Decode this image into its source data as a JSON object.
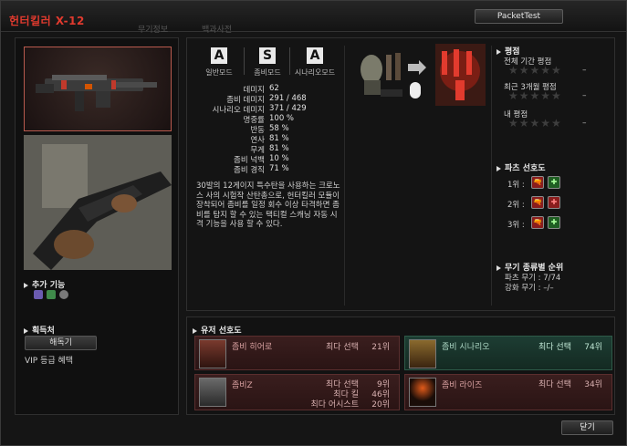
{
  "window": {
    "title": "헌터킬러 X-12",
    "ghost_tabs": [
      "무기정보",
      "백과사전"
    ],
    "top_button": "PacketTest",
    "close_button": "닫기"
  },
  "left": {
    "features_heading": "추가 기능",
    "acquisition_heading": "획득처",
    "dismantle_button": "해독기",
    "vip_text": "VIP 등급 혜택"
  },
  "modes": [
    {
      "grade": "A",
      "label": "일반모드"
    },
    {
      "grade": "S",
      "label": "좀비모드"
    },
    {
      "grade": "A",
      "label": "시나리오모드"
    }
  ],
  "stats": [
    {
      "key": "데미지",
      "value": "62"
    },
    {
      "key": "좀비 데미지",
      "value": "291 / 468"
    },
    {
      "key": "시나리오 데미지",
      "value": "371 / 429"
    },
    {
      "key": "명중률",
      "value": "100 %"
    },
    {
      "key": "반동",
      "value": "58 %"
    },
    {
      "key": "연사",
      "value": "81 %"
    },
    {
      "key": "무게",
      "value": "81 %"
    },
    {
      "key": "좀비 넉백",
      "value": "10 %"
    },
    {
      "key": "좀비 경직",
      "value": "71 %"
    }
  ],
  "description": "30발의 12게이지 특수탄을 사용하는 크로노스 사의 시험작 산탄총으로, 헌터킬러 모듈이 장착되어 좀비를 일정 회수 이상 타격하면 좀비를 탐지 할 수 있는 택티컬 스캐닝 자동 시격 기능을 사용 할 수 있다.",
  "ratings": {
    "heading": "평점",
    "items": [
      {
        "label": "전체 기간 평점",
        "stars": "★★★★★",
        "value": "–"
      },
      {
        "label": "최근 3개월 평점",
        "stars": "★★★★★",
        "value": "–"
      },
      {
        "label": "내 평점",
        "stars": "★★★★★",
        "value": "–"
      }
    ]
  },
  "faction": {
    "heading": "파츠 선호도",
    "ranks": [
      {
        "label": "1위 :",
        "badge_a": "🔫",
        "badge_b": "✚"
      },
      {
        "label": "2위 :",
        "badge_a": "🔫",
        "badge_b": "✚"
      },
      {
        "label": "3위 :",
        "badge_a": "🔫",
        "badge_b": "✚"
      }
    ]
  },
  "weapon_rank": {
    "heading": "무기 종류별 순위",
    "lines": [
      "파츠 무기 : 7/74",
      "강화 무기 : –/–"
    ]
  },
  "user_pref": {
    "heading": "유저 선호도",
    "cards": [
      {
        "name": "좀비 히어로",
        "lines": [
          {
            "label": "최다 선택",
            "value": "21위"
          }
        ],
        "theme": "red"
      },
      {
        "name": "좀비 시나리오",
        "lines": [
          {
            "label": "최다 선택",
            "value": "74위"
          }
        ],
        "theme": "green"
      },
      {
        "name": "좀비Z",
        "lines": [
          {
            "label": "최다 선택",
            "value": "9위"
          },
          {
            "label": "최다 킬",
            "value": "46위"
          },
          {
            "label": "최다 어시스트",
            "value": "20위"
          }
        ],
        "theme": "red"
      },
      {
        "name": "좀비 라이즈",
        "lines": [
          {
            "label": "최다 선택",
            "value": "34위"
          }
        ],
        "theme": "red"
      }
    ]
  },
  "colors": {
    "title_red": "#e03a2e",
    "card_red": "#3a1e1e",
    "card_green": "#1d3d33"
  }
}
